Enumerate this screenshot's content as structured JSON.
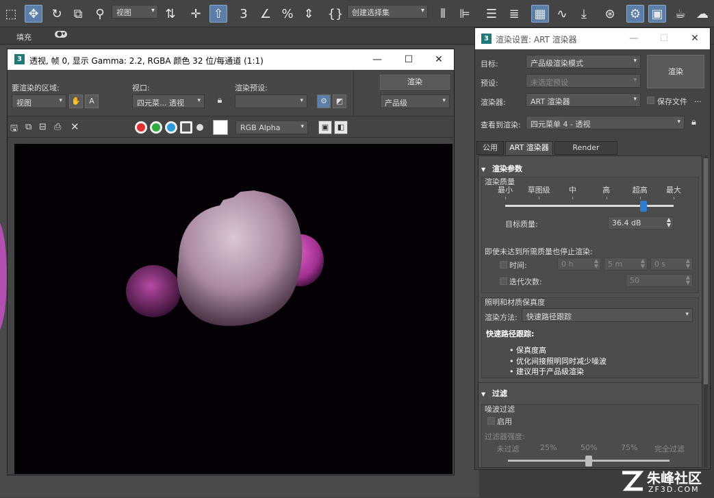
{
  "toolbar": {
    "view_combo": "视图",
    "selection_set_combo": "创建选择集"
  },
  "ribbon": {
    "fill_label": "填充"
  },
  "frame_window": {
    "badge": "3",
    "title": "透视, 帧 0, 显示 Gamma: 2.2, RGBA 颜色 32 位/每通道 (1:1)",
    "area_label": "要渲染的区域:",
    "area_value": "视图",
    "viewport_label": "视口:",
    "viewport_value": "四元菜... 透视",
    "preset_label": "渲染预设:",
    "preset_value": "",
    "render_button": "渲染",
    "quality_value": "产品级",
    "channel_value": "RGB Alpha",
    "close_glyph": "✕",
    "minimize_glyph": "—",
    "maximize_glyph": "☐"
  },
  "render_dialog": {
    "badge": "3",
    "title": "渲染设置: ART 渲染器",
    "target_label": "目标:",
    "target_value": "产品级渲染模式",
    "preset_label": "预设:",
    "preset_value": "未选定预设",
    "renderer_label": "渲染器:",
    "renderer_value": "ART 渲染器",
    "save_file_label": "保存文件",
    "more_glyph": "...",
    "view_label": "查看到渲染:",
    "view_value": "四元菜单 4 - 透视",
    "render_button": "渲染",
    "tabs": [
      "公用",
      "ART 渲染器",
      "Render Elements"
    ],
    "render_params": {
      "header": "渲染参数",
      "quality_group": "渲染质量",
      "levels": [
        "最小",
        "草图级",
        "中",
        "高",
        "超高",
        "最大"
      ],
      "quality_level": 0.82,
      "target_quality_label": "目标质量:",
      "target_quality_value": "36.4 dB",
      "stop_label": "即使未达到所需质量也停止渲染:",
      "time_label": "时间:",
      "time_h": "0 h",
      "time_m": "5 m",
      "time_s": "0 s",
      "iter_label": "迭代次数:",
      "iter_value": "50",
      "lighting_group": "照明和材质保真度",
      "method_label": "渲染方法:",
      "method_value": "快速路径跟踪",
      "fast_header": "快速路径跟踪:",
      "bullets": [
        "保真度高",
        "优化间接照明同时减少噪波",
        "建议用于产品级渲染"
      ]
    },
    "filter": {
      "header": "过滤",
      "noise_group": "噪波过滤",
      "enable_label": "启用",
      "strength_label": "过滤器强度:",
      "levels": [
        "未过滤",
        "25%",
        "50%",
        "75%",
        "完全过滤"
      ],
      "strength_value": 0.5
    }
  },
  "watermark": {
    "text": "朱峰社区",
    "domain": "ZF3D.COM"
  }
}
